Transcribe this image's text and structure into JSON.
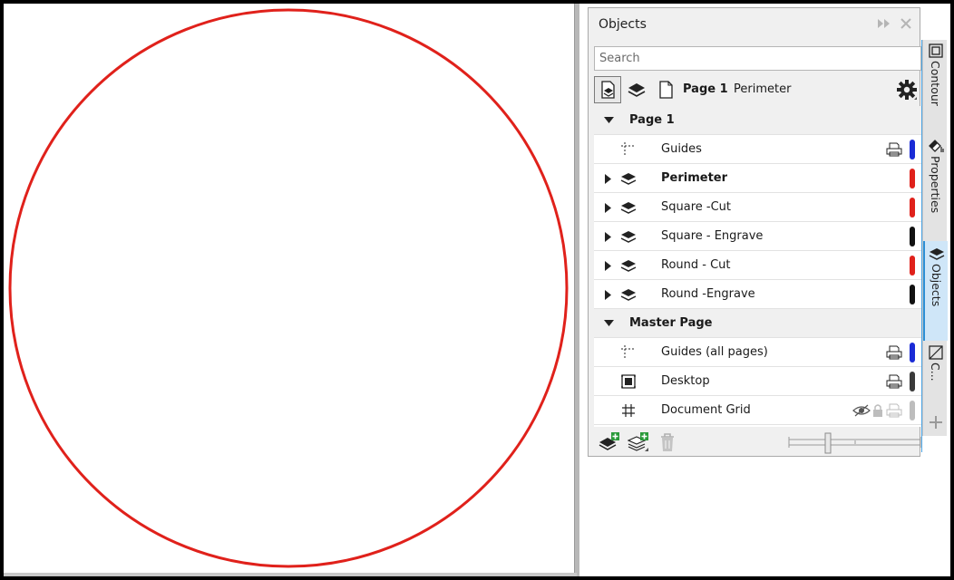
{
  "docker": {
    "title": "Objects",
    "search_placeholder": "Search",
    "toolbar": {
      "page_label": "Page 1",
      "layer_label": "Perimeter"
    }
  },
  "tree": {
    "page_group": "Page 1",
    "page_layers": [
      {
        "label": "Guides",
        "type": "guides",
        "color": "#1a2bd6",
        "bold": false
      },
      {
        "label": "Perimeter",
        "type": "layer",
        "color": "#e0211b",
        "bold": true
      },
      {
        "label": "Square -Cut",
        "type": "layer",
        "color": "#e0211b",
        "bold": false
      },
      {
        "label": "Square - Engrave",
        "type": "layer",
        "color": "#111111",
        "bold": false
      },
      {
        "label": "Round - Cut",
        "type": "layer",
        "color": "#e0211b",
        "bold": false
      },
      {
        "label": "Round -Engrave",
        "type": "layer",
        "color": "#111111",
        "bold": false
      }
    ],
    "master_group": "Master Page",
    "master_layers": [
      {
        "label": "Guides (all pages)",
        "type": "guides",
        "color": "#1a2bd6"
      },
      {
        "label": "Desktop",
        "type": "desktop",
        "color": "#3a3a3a"
      },
      {
        "label": "Document Grid",
        "type": "grid",
        "color": "#bdbdbd"
      }
    ]
  },
  "side_tabs": {
    "contour": "Contour",
    "properties": "Properties",
    "objects": "Objects",
    "c": "C..."
  },
  "colors": {
    "circle_stroke": "#e0211b",
    "accent": "#2b8fd6"
  }
}
